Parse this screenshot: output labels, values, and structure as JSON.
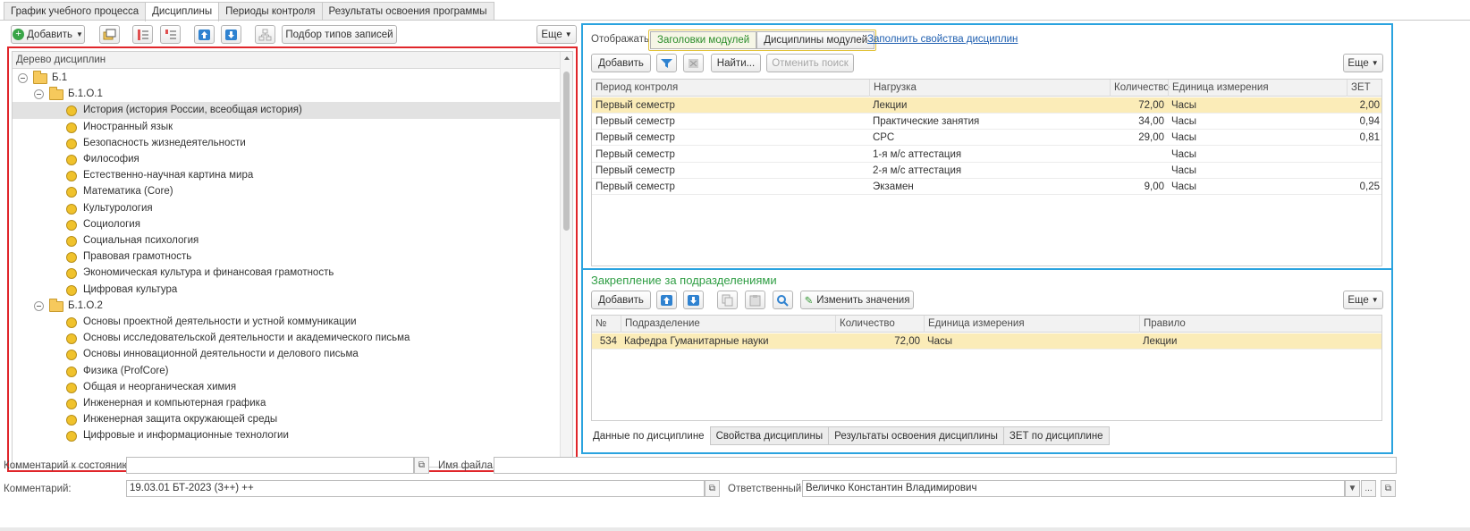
{
  "top_tabs": [
    "График учебного процесса",
    "Дисциплины",
    "Периоды контроля",
    "Результаты освоения программы"
  ],
  "left_toolbar": {
    "add_label": "Добавить",
    "record_types_label": "Подбор типов записей",
    "more_label": "Еще"
  },
  "tree": {
    "header": "Дерево дисциплин",
    "rows": [
      {
        "level": 0,
        "type": "folder",
        "label": "Б.1"
      },
      {
        "level": 1,
        "type": "folder",
        "label": "Б.1.О.1"
      },
      {
        "level": 2,
        "type": "item",
        "label": "История (история России, всеобщая история)",
        "selected": true
      },
      {
        "level": 2,
        "type": "item",
        "label": "Иностранный язык"
      },
      {
        "level": 2,
        "type": "item",
        "label": "Безопасность жизнедеятельности"
      },
      {
        "level": 2,
        "type": "item",
        "label": "Философия"
      },
      {
        "level": 2,
        "type": "item",
        "label": "Естественно-научная картина мира"
      },
      {
        "level": 2,
        "type": "item",
        "label": "Математика (Core)"
      },
      {
        "level": 2,
        "type": "item",
        "label": "Культурология"
      },
      {
        "level": 2,
        "type": "item",
        "label": "Социология"
      },
      {
        "level": 2,
        "type": "item",
        "label": "Социальная психология"
      },
      {
        "level": 2,
        "type": "item",
        "label": "Правовая грамотность"
      },
      {
        "level": 2,
        "type": "item",
        "label": "Экономическая культура и финансовая грамотность"
      },
      {
        "level": 2,
        "type": "item",
        "label": "Цифровая культура"
      },
      {
        "level": 1,
        "type": "folder",
        "label": "Б.1.О.2"
      },
      {
        "level": 2,
        "type": "item",
        "label": "Основы проектной деятельности и устной коммуникации"
      },
      {
        "level": 2,
        "type": "item",
        "label": "Основы исследовательской деятельности и академического письма"
      },
      {
        "level": 2,
        "type": "item",
        "label": "Основы инновационной деятельности и делового письма"
      },
      {
        "level": 2,
        "type": "item",
        "label": "Физика (ProfCore)"
      },
      {
        "level": 2,
        "type": "item",
        "label": "Общая и неорганическая химия"
      },
      {
        "level": 2,
        "type": "item",
        "label": "Инженерная и компьютерная графика"
      },
      {
        "level": 2,
        "type": "item",
        "label": "Инженерная защита окружающей среды"
      },
      {
        "level": 2,
        "type": "item",
        "label": "Цифровые и информационные технологии"
      }
    ]
  },
  "display": {
    "label": "Отображать:",
    "options": [
      "Заголовки модулей",
      "Дисциплины модулей"
    ],
    "fill_link": "Заполнить свойства дисциплин"
  },
  "load_toolbar": {
    "add_label": "Добавить",
    "find_label": "Найти...",
    "cancel_search_label": "Отменить поиск",
    "more_label": "Еще"
  },
  "load_table": {
    "columns": [
      "Период контроля",
      "Нагрузка",
      "Количество",
      "Единица измерения",
      "ЗЕТ"
    ],
    "rows": [
      [
        "Первый семестр",
        "Лекции",
        "72,00",
        "Часы",
        "2,00"
      ],
      [
        "Первый семестр",
        "Практические занятия",
        "34,00",
        "Часы",
        "0,94"
      ],
      [
        "Первый семестр",
        "СРС",
        "29,00",
        "Часы",
        "0,81"
      ],
      [
        "Первый семестр",
        "1-я м/с аттестация",
        "",
        "Часы",
        ""
      ],
      [
        "Первый семестр",
        "2-я м/с аттестация",
        "",
        "Часы",
        ""
      ],
      [
        "Первый семестр",
        "Экзамен",
        "9,00",
        "Часы",
        "0,25"
      ]
    ]
  },
  "assign": {
    "title": "Закрепление за подразделениями",
    "add_label": "Добавить",
    "change_label": "Изменить значения",
    "more_label": "Еще",
    "columns": [
      "№",
      "Подразделение",
      "Количество",
      "Единица измерения",
      "Правило"
    ],
    "rows": [
      [
        "534",
        "Кафедра Гуманитарные науки",
        "72,00",
        "Часы",
        "Лекции"
      ]
    ]
  },
  "bottom_tabs": [
    "Данные по дисциплине",
    "Свойства дисциплины",
    "Результаты освоения дисциплины",
    "ЗЕТ по дисциплине"
  ],
  "footer": {
    "state_comment_label": "Комментарий к состоянию:",
    "state_comment_value": "",
    "file_name_label": "Имя файла:",
    "file_name_value": "",
    "comment_label": "Комментарий:",
    "comment_value": "19.03.01 БТ-2023 (3++) ++",
    "responsible_label": "Ответственный:",
    "responsible_value": "Величко Константин Владимирович"
  },
  "colors": {
    "red_frame": "#e0262b",
    "blue_frame": "#2aa3df",
    "selected_row": "#fbecb8",
    "accent_green": "#2f9e44",
    "link": "#1f5fb0"
  }
}
